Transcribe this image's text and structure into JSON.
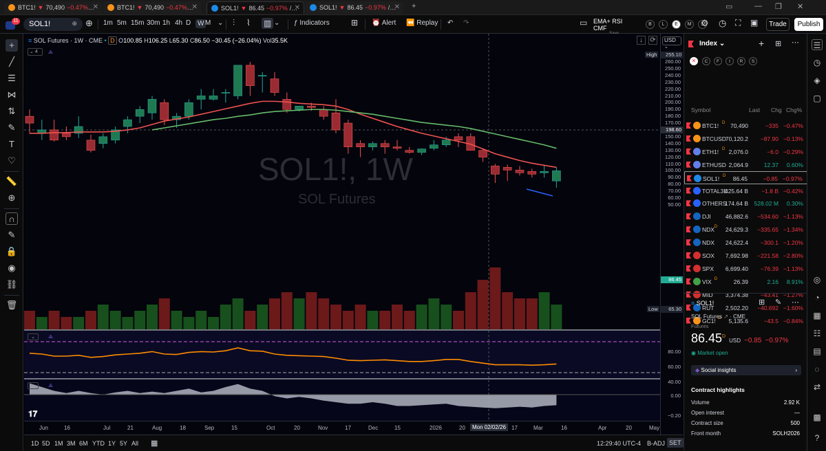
{
  "browser": {
    "tabs": [
      {
        "symbol": "BTC1!",
        "arrow": "▼",
        "price": "70,490",
        "change": "−0.47%",
        "rest": "/ 4 s",
        "color": "#f7931a"
      },
      {
        "symbol": "BTC1!",
        "arrow": "▼",
        "price": "70,490",
        "change": "−0.47%",
        "rest": "/ BI",
        "color": "#f7931a"
      },
      {
        "symbol": "SOL1!",
        "arrow": "▼",
        "price": "86.45",
        "change": "−0.97%",
        "rest": "/ EMA",
        "color": "#1e88e5"
      },
      {
        "symbol": "SOL1!",
        "arrow": "▼",
        "price": "86.45",
        "change": "−0.97%",
        "rest": "/ EMA",
        "color": "#1e88e5"
      }
    ]
  },
  "toolbar": {
    "symbol": "SOL1!",
    "intervals": [
      "1m",
      "5m",
      "15m",
      "30m",
      "1h",
      "4h",
      "D",
      "W",
      "M"
    ],
    "selected_interval": "W",
    "indicators_label": "Indicators",
    "alert_label": "Alert",
    "replay_label": "Replay",
    "layout_name": "EMA+ RSI CMF",
    "layout_sub": "Save",
    "layout_badges": [
      "B",
      "L",
      "E",
      "M",
      "S"
    ],
    "trade_label": "Trade",
    "publish_label": "Publish",
    "notif_count": "11"
  },
  "chart": {
    "legend": {
      "title": "SOL Futures · 1W · CME",
      "open_lbl": "O",
      "open": "100.85",
      "high_lbl": "H",
      "high": "106.25",
      "low_lbl": "L",
      "low": "65.30",
      "close_lbl": "C",
      "close": "86.50",
      "change": "−30.45 (−26.04%)",
      "vol_lbl": "Vol",
      "vol": "35.5K",
      "badge": "D"
    },
    "indicator_count": "4",
    "watermark_symbol": "SOL1!, 1W",
    "watermark_name": "SOL Futures",
    "currency": "USD",
    "price_labels": [
      "260.00",
      "250.00",
      "240.00",
      "230.00",
      "220.00",
      "210.00",
      "200.00",
      "190.00",
      "180.00",
      "170.00",
      "160.00",
      "150.00",
      "140.00",
      "130.00",
      "120.00",
      "110.00",
      "100.00",
      "90.00",
      "80.00",
      "70.00",
      "60.00",
      "50.00"
    ],
    "high_tag_label": "High",
    "high_tag_value": "255.10",
    "cross_value": "198.60",
    "last_value": "86.45",
    "low_tag_label": "Low",
    "low_tag_value": "65.30",
    "rsi_labels": [
      "80.00",
      "60.00",
      "40.00"
    ],
    "cmf_labels": [
      "0.00",
      "−0.20"
    ],
    "time_labels": [
      "Jun",
      "16",
      "Jul",
      "21",
      "Aug",
      "18",
      "Sep",
      "15",
      "Oct",
      "20",
      "Nov",
      "17",
      "Dec",
      "15",
      "2026",
      "20",
      "Mon 02/02/26",
      "17",
      "Mar",
      "16",
      "Apr",
      "20",
      "May"
    ]
  },
  "bottom": {
    "ranges": [
      "1D",
      "5D",
      "1M",
      "3M",
      "6M",
      "YTD",
      "1Y",
      "5Y",
      "All"
    ],
    "time": "12:29:40 UTC-4",
    "badj": "B-ADJ",
    "set": "SET"
  },
  "watchlist": {
    "title": "Index",
    "cols": [
      "Symbol",
      "Last",
      "Chg",
      "Chg%"
    ],
    "filters": [
      "C",
      "F",
      "I",
      "R",
      "S"
    ],
    "rows": [
      {
        "s": "BTC1!",
        "d": "D",
        "l": "70,490",
        "c": "−335",
        "p": "−0.47%",
        "up": false,
        "ic": "#f7931a"
      },
      {
        "s": "BTCUSD",
        "d": "",
        "l": "70,120.2",
        "c": "−87.90",
        "p": "−0.13%",
        "up": false,
        "ic": "#f7931a"
      },
      {
        "s": "ETH1!",
        "d": "D",
        "l": "2,076.0",
        "c": "−6.0",
        "p": "−0.29%",
        "up": false,
        "ic": "#627eea"
      },
      {
        "s": "ETHUSD",
        "d": "",
        "l": "2,064.9",
        "c": "12.37",
        "p": "0.60%",
        "up": true,
        "ic": "#627eea"
      },
      {
        "s": "SOL1!",
        "d": "D",
        "l": "86.45",
        "c": "−0.85",
        "p": "−0.97%",
        "up": false,
        "ic": "#1e88e5"
      },
      {
        "s": "TOTAL3E",
        "d": "",
        "l": "425.64 B",
        "c": "−1.8 B",
        "p": "−0.42%",
        "up": false,
        "ic": "#2962ff"
      },
      {
        "s": "OTHERS",
        "d": "",
        "l": "174.64 B",
        "c": "528.02 M",
        "p": "0.30%",
        "up": true,
        "ic": "#2962ff"
      },
      {
        "s": "DJI",
        "d": "",
        "l": "46,882.6",
        "c": "−534.60",
        "p": "−1.13%",
        "up": false,
        "ic": "#1565c0"
      },
      {
        "s": "NDX",
        "d": "D",
        "l": "24,629.3",
        "c": "−335.65",
        "p": "−1.34%",
        "up": false,
        "ic": "#1565c0"
      },
      {
        "s": "NDX",
        "d": "",
        "l": "24,622.4",
        "c": "−300.1",
        "p": "−1.20%",
        "up": false,
        "ic": "#1565c0"
      },
      {
        "s": "SOX",
        "d": "",
        "l": "7,692.98",
        "c": "−221.58",
        "p": "−2.80%",
        "up": false,
        "ic": "#d32f2f"
      },
      {
        "s": "SPX",
        "d": "",
        "l": "6,699.40",
        "c": "−76.39",
        "p": "−1.13%",
        "up": false,
        "ic": "#d32f2f"
      },
      {
        "s": "VIX",
        "d": "D",
        "l": "26.39",
        "c": "2.16",
        "p": "8.91%",
        "up": true,
        "ic": "#43a047"
      },
      {
        "s": "MID",
        "d": "",
        "l": "3,374.38",
        "c": "−43.41",
        "p": "−1.27%",
        "up": false,
        "ic": "#d32f2f"
      },
      {
        "s": "RUT",
        "d": "",
        "l": "2,502.20",
        "c": "−40.692",
        "p": "−1.60%",
        "up": false,
        "ic": "#1565c0"
      },
      {
        "s": "GC1!",
        "d": "D",
        "l": "5,135.6",
        "c": "−43.5",
        "p": "−0.84%",
        "up": false,
        "ic": "#f7931a"
      }
    ]
  },
  "details": {
    "symbol": "SOL1!",
    "name": "SOL Futures",
    "exchange": "CME",
    "type": "Futures",
    "price": "86.45",
    "price_suffix": "D",
    "currency": "USD",
    "change": "−0.85",
    "change_pct": "−0.97%",
    "market_status": "Market open",
    "social": "Social insights",
    "highlights_title": "Contract highlights",
    "highlights": [
      {
        "k": "Volume",
        "v": "2.92 K"
      },
      {
        "k": "Open interest",
        "v": "—"
      },
      {
        "k": "Contract size",
        "v": "500"
      },
      {
        "k": "Front month",
        "v": "SOLH2026"
      }
    ]
  }
}
